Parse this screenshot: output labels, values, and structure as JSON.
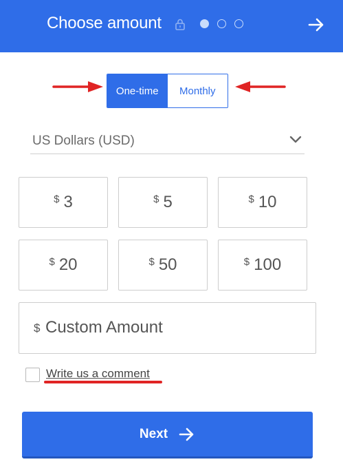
{
  "header": {
    "title": "Choose amount",
    "lock_icon": "lock-icon",
    "steps_total": 3,
    "current_step": 1,
    "next_icon": "arrow-right-icon",
    "background_color": "#2f6de8"
  },
  "frequency": {
    "options": [
      "One-time",
      "Monthly"
    ],
    "selected": "One-time"
  },
  "currency": {
    "selected": "US Dollars (USD)",
    "chevron_icon": "chevron-down-icon"
  },
  "amounts": [
    {
      "symbol": "$",
      "value": "3"
    },
    {
      "symbol": "$",
      "value": "5"
    },
    {
      "symbol": "$",
      "value": "10"
    },
    {
      "symbol": "$",
      "value": "20"
    },
    {
      "symbol": "$",
      "value": "50"
    },
    {
      "symbol": "$",
      "value": "100"
    }
  ],
  "custom_amount": {
    "symbol": "$",
    "placeholder": "Custom Amount",
    "value": ""
  },
  "comment": {
    "label": "Write us a comment",
    "checked": false
  },
  "next_button": {
    "label": "Next",
    "icon": "arrow-right-icon"
  },
  "annotations": {
    "arrow_color": "#e02424"
  }
}
